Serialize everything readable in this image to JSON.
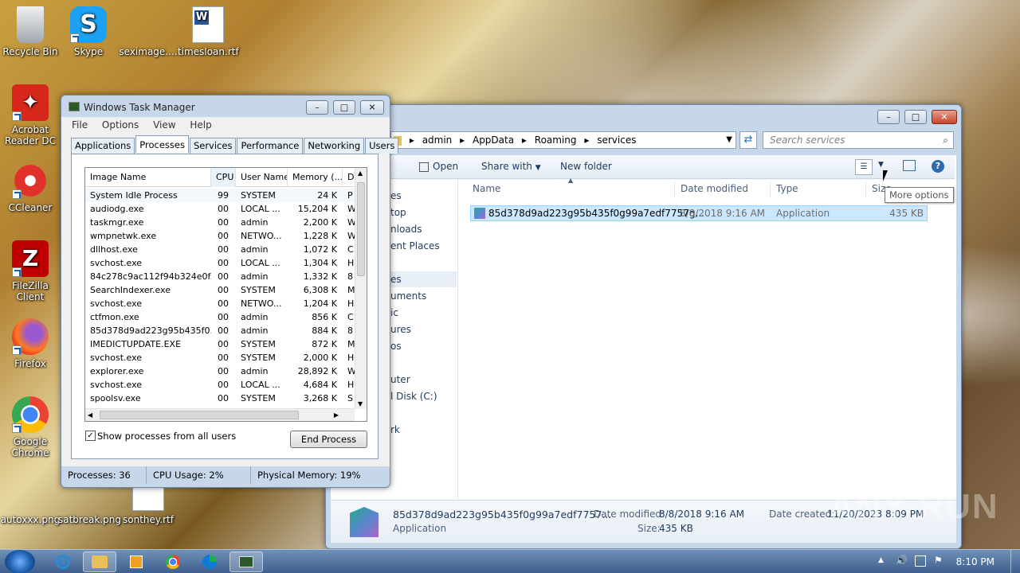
{
  "desktop": {
    "icons": [
      {
        "label": "Recycle Bin"
      },
      {
        "label": "Skype"
      },
      {
        "label": "seximage...."
      },
      {
        "label": "timesloan.rtf"
      },
      {
        "label": "Acrobat Reader DC"
      },
      {
        "label": "CCleaner"
      },
      {
        "label": "FileZilla Client"
      },
      {
        "label": "Firefox"
      },
      {
        "label": "Google Chrome"
      },
      {
        "label": "autoxxx.png"
      },
      {
        "label": "satbreak.png"
      },
      {
        "label": "sonthey.rtf"
      }
    ]
  },
  "taskmgr": {
    "title": "Windows Task Manager",
    "menu": [
      "File",
      "Options",
      "View",
      "Help"
    ],
    "tabs": [
      "Applications",
      "Processes",
      "Services",
      "Performance",
      "Networking",
      "Users"
    ],
    "columns": [
      "Image Name",
      "CPU",
      "User Name",
      "Memory (...",
      "D"
    ],
    "rows": [
      {
        "name": "System Idle Process",
        "cpu": "99",
        "user": "SYSTEM",
        "mem": "24 K",
        "d": "P"
      },
      {
        "name": "audiodg.exe",
        "cpu": "00",
        "user": "LOCAL ...",
        "mem": "15,204 K",
        "d": "W"
      },
      {
        "name": "taskmgr.exe",
        "cpu": "00",
        "user": "admin",
        "mem": "2,200 K",
        "d": "W"
      },
      {
        "name": "wmpnetwk.exe",
        "cpu": "00",
        "user": "NETWO...",
        "mem": "1,228 K",
        "d": "W"
      },
      {
        "name": "dllhost.exe",
        "cpu": "00",
        "user": "admin",
        "mem": "1,072 K",
        "d": "C"
      },
      {
        "name": "svchost.exe",
        "cpu": "00",
        "user": "LOCAL ...",
        "mem": "1,304 K",
        "d": "H"
      },
      {
        "name": "84c278c9ac112f94b324e0f...",
        "cpu": "00",
        "user": "admin",
        "mem": "1,332 K",
        "d": "8"
      },
      {
        "name": "SearchIndexer.exe",
        "cpu": "00",
        "user": "SYSTEM",
        "mem": "6,308 K",
        "d": "M"
      },
      {
        "name": "svchost.exe",
        "cpu": "00",
        "user": "NETWO...",
        "mem": "1,204 K",
        "d": "H"
      },
      {
        "name": "ctfmon.exe",
        "cpu": "00",
        "user": "admin",
        "mem": "856 K",
        "d": "C"
      },
      {
        "name": "85d378d9ad223g95b435f0...",
        "cpu": "00",
        "user": "admin",
        "mem": "884 K",
        "d": "8"
      },
      {
        "name": "IMEDICTUPDATE.EXE",
        "cpu": "00",
        "user": "SYSTEM",
        "mem": "872 K",
        "d": "M"
      },
      {
        "name": "svchost.exe",
        "cpu": "00",
        "user": "SYSTEM",
        "mem": "2,000 K",
        "d": "H"
      },
      {
        "name": "explorer.exe",
        "cpu": "00",
        "user": "admin",
        "mem": "28,892 K",
        "d": "W"
      },
      {
        "name": "svchost.exe",
        "cpu": "00",
        "user": "LOCAL ...",
        "mem": "4,684 K",
        "d": "H"
      },
      {
        "name": "spoolsv.exe",
        "cpu": "00",
        "user": "SYSTEM",
        "mem": "3,268 K",
        "d": "S"
      },
      {
        "name": "svchost.exe",
        "cpu": "00",
        "user": "NETWO...",
        "mem": "5,000 K",
        "d": "H"
      }
    ],
    "show_all_label": "Show processes from all users",
    "end_process_label": "End Process",
    "status": {
      "processes": "Processes: 36",
      "cpu": "CPU Usage: 2%",
      "memory": "Physical Memory: 19%"
    }
  },
  "explorer": {
    "breadcrumb": [
      "admin",
      "AppData",
      "Roaming",
      "services"
    ],
    "search_placeholder": "Search services",
    "toolbar": {
      "open": "Open",
      "share": "Share with",
      "new_folder": "New folder"
    },
    "nav": [
      "es",
      "top",
      "nloads",
      "ent Places",
      "es",
      "uments",
      "ic",
      "ures",
      "os",
      "uter",
      "l Disk (C:)",
      "rk"
    ],
    "columns": {
      "name": "Name",
      "date": "Date modified",
      "type": "Type",
      "size": "Size"
    },
    "file": {
      "name": "85d378d9ad223g95b435f0g99a7edf7757g...",
      "date": "8/8/2018 9:16 AM",
      "type": "Application",
      "size": "435 KB"
    },
    "tooltip": "More options",
    "details": {
      "name": "85d378d9ad223g95b435f0g99a7edf7757...",
      "type": "Application",
      "date_modified_label": "Date modified:",
      "date_modified": "8/8/2018 9:16 AM",
      "size_label": "Size:",
      "size": "435 KB",
      "date_created_label": "Date created:",
      "date_created": "11/20/2023 8:09 PM"
    }
  },
  "taskbar": {
    "clock": "8:10 PM"
  },
  "watermark": "ANY RUN",
  "colors": {
    "accent": "#1a5fbf",
    "selection": "#cce8ff",
    "taskbar": "#3e5f8c"
  }
}
